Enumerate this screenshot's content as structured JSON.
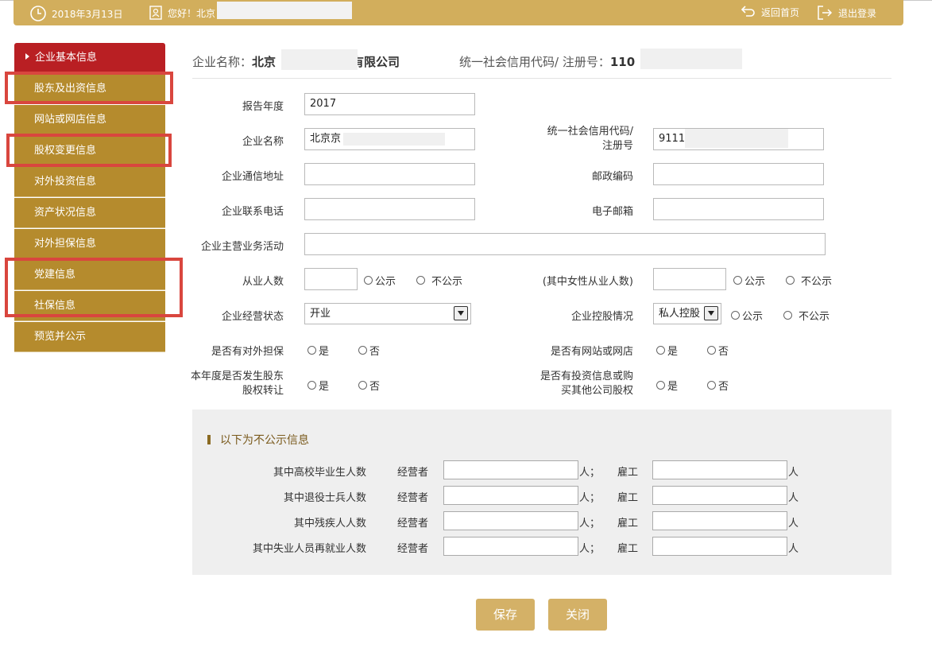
{
  "topbar": {
    "date": "2018年3月13日",
    "greeting": "您好！北京",
    "home": "返回首页",
    "logout": "退出登录"
  },
  "sidebar": {
    "items": [
      {
        "label": "企业基本信息"
      },
      {
        "label": "股东及出资信息"
      },
      {
        "label": "网站或网店信息"
      },
      {
        "label": "股权变更信息"
      },
      {
        "label": "对外投资信息"
      },
      {
        "label": "资产状况信息"
      },
      {
        "label": "对外担保信息"
      },
      {
        "label": "党建信息"
      },
      {
        "label": "社保信息"
      },
      {
        "label": "预览并公示"
      }
    ]
  },
  "header": {
    "name_label": "企业名称：",
    "name_prefix": "北京",
    "name_suffix": "有限公司",
    "code_label": "统一社会信用代码/ 注册号：",
    "code_prefix": "110"
  },
  "form": {
    "report_year_label": "报告年度",
    "report_year_value": "2017",
    "company_name_label": "企业名称",
    "company_name_value": "北京京",
    "credit_code_label_1": "统一社会信用代码/",
    "credit_code_label_2": "注册号",
    "credit_code_value": "9111",
    "address_label": "企业通信地址",
    "postcode_label": "邮政编码",
    "phone_label": "企业联系电话",
    "email_label": "电子邮箱",
    "business_label": "企业主营业务活动",
    "employees_label": "从业人数",
    "female_label": "(其中女性从业人数)",
    "public": "公示",
    "not_public": "不公示",
    "status_label": "企业经营状态",
    "status_value": "开业",
    "holding_label": "企业控股情况",
    "holding_value": "私人控股",
    "guarantee_label": "是否有对外担保",
    "website_label": "是否有网站或网店",
    "transfer_label_1": "本年度是否发生股东",
    "transfer_label_2": "股权转让",
    "invest_label_1": "是否有投资信息或购",
    "invest_label_2": "买其他公司股权",
    "yes": "是",
    "no": "否"
  },
  "nonpublic": {
    "title": "以下为不公示信息",
    "operator": "经营者",
    "employee": "雇工",
    "person_sep": "人；",
    "person": "人",
    "rows": [
      {
        "label": "其中高校毕业生人数"
      },
      {
        "label": "其中退役士兵人数"
      },
      {
        "label": "其中残疾人人数"
      },
      {
        "label": "其中失业人员再就业人数"
      }
    ]
  },
  "buttons": {
    "save": "保存",
    "close": "关闭"
  },
  "colors": {
    "gold": "#d2ae5c",
    "sidebar": "#b58b2d",
    "active": "#b91f23",
    "highlight": "#d9463e"
  }
}
